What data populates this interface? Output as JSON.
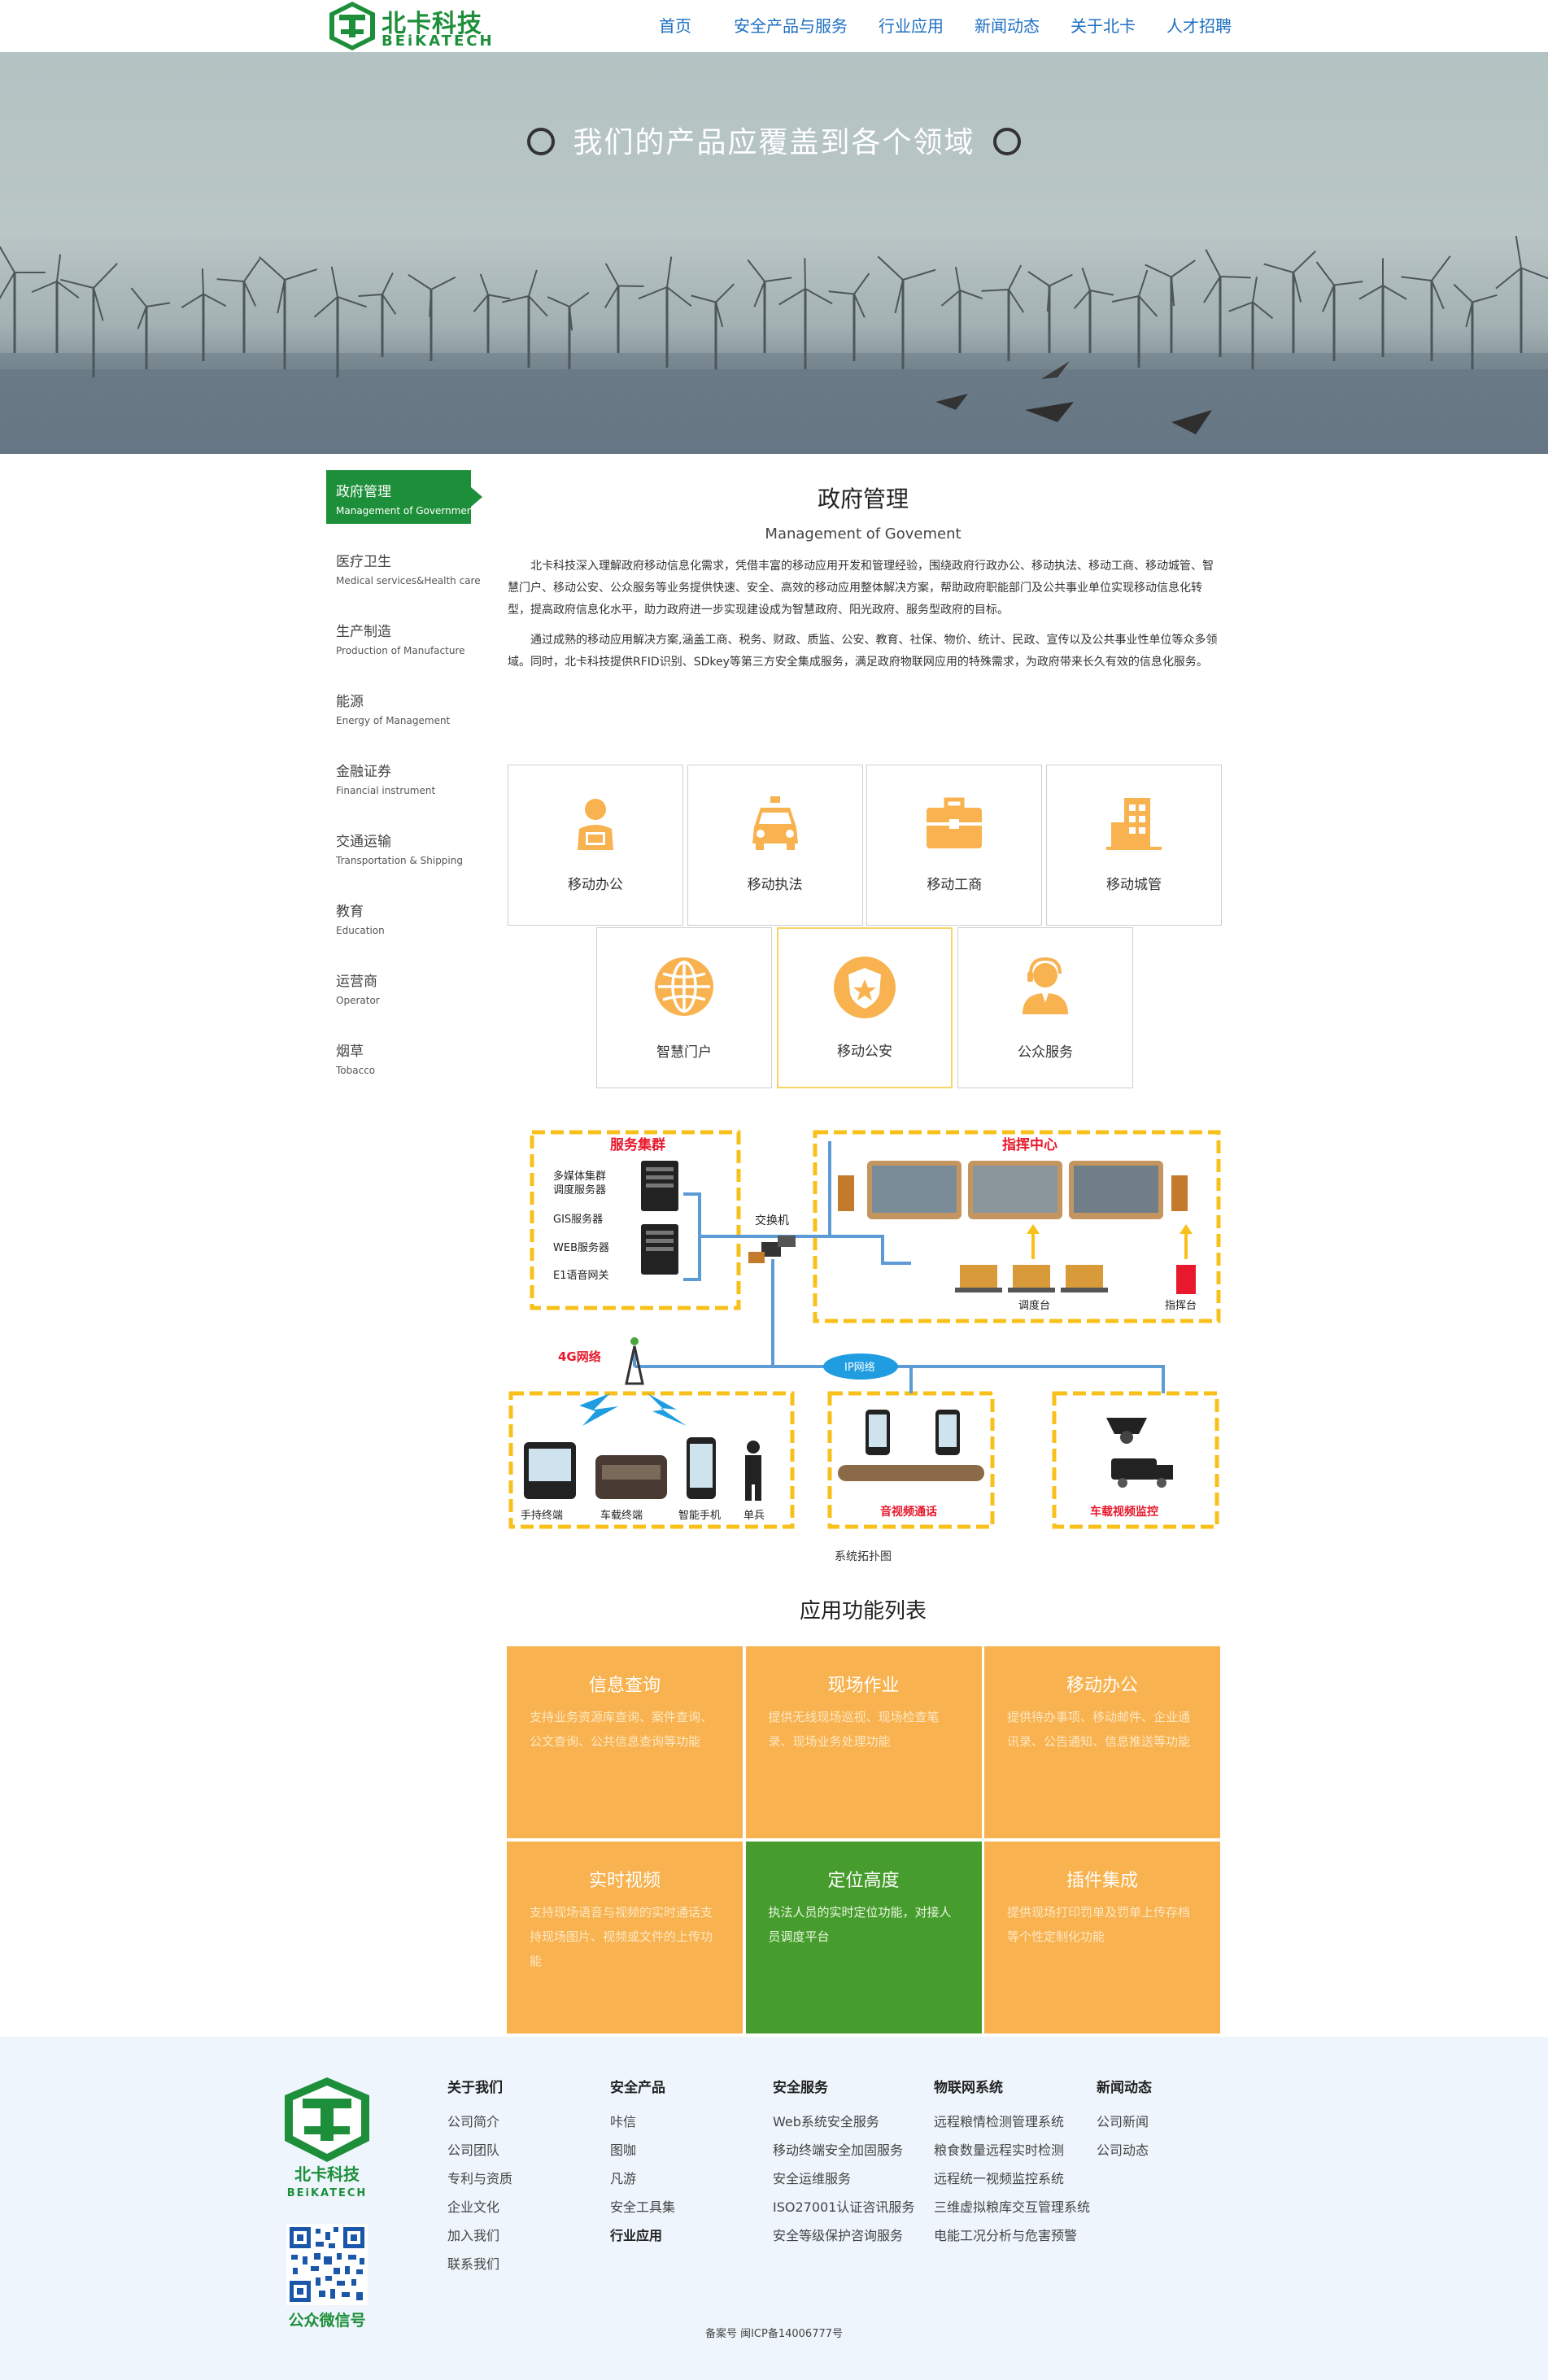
{
  "brand": {
    "name_cn": "北卡科技",
    "name_en": "BEiKATECH"
  },
  "nav": [
    "首页",
    "安全产品与服务",
    "行业应用",
    "新闻动态",
    "关于北卡",
    "人才招聘"
  ],
  "banner": {
    "title": "我们的产品应覆盖到各个领域"
  },
  "sidebar": [
    {
      "cn": "政府管理",
      "en": "Management of Government",
      "active": true
    },
    {
      "cn": "医疗卫生",
      "en": "Medical services&Health care"
    },
    {
      "cn": "生产制造",
      "en": "Production of Manufacture"
    },
    {
      "cn": "能源",
      "en": "Energy of Management"
    },
    {
      "cn": "金融证券",
      "en": "Financial instrument"
    },
    {
      "cn": "交通运输",
      "en": "Transportation & Shipping"
    },
    {
      "cn": "教育",
      "en": "Education"
    },
    {
      "cn": "运营商",
      "en": "Operator"
    },
    {
      "cn": "烟草",
      "en": "Tobacco"
    }
  ],
  "main": {
    "title_cn": "政府管理",
    "title_en": "Management of Govement",
    "paragraphs": [
      "北卡科技深入理解政府移动信息化需求，凭借丰富的移动应用开发和管理经验，围绕政府行政办公、移动执法、移动工商、移动城管、智慧门户、移动公安、公众服务等业务提供快速、安全、高效的移动应用整体解决方案，帮助政府职能部门及公共事业单位实现移动信息化转型，提高政府信息化水平，助力政府进一步实现建设成为智慧政府、阳光政府、服务型政府的目标。",
      "通过成熟的移动应用解决方案,涵盖工商、税务、财政、质监、公安、教育、社保、物价、统计、民政、宣传以及公共事业性单位等众多领域。同时，北卡科技提供RFID识别、SDkey等第三方安全集成服务，满足政府物联网应用的特殊需求，为政府带来长久有效的信息化服务。"
    ],
    "cards": [
      {
        "label": "移动办公",
        "icon": "office-worker-icon"
      },
      {
        "label": "移动执法",
        "icon": "police-car-icon"
      },
      {
        "label": "移动工商",
        "icon": "briefcase-icon"
      },
      {
        "label": "移动城管",
        "icon": "building-icon"
      },
      {
        "label": "智慧门户",
        "icon": "globe-icon"
      },
      {
        "label": "移动公安",
        "icon": "police-badge-icon"
      },
      {
        "label": "公众服务",
        "icon": "customer-service-icon"
      }
    ],
    "accent_color": "#f8b24f"
  },
  "topology": {
    "server_group": "服务集群",
    "servers": [
      "多媒体集群",
      "调度服务器",
      "GIS服务器",
      "WEB服务器",
      "E1语音网关"
    ],
    "switch": "交换机",
    "command_center": "指挥中心",
    "dispatch": "调度台",
    "command_desk": "指挥台",
    "network_4g": "4G网络",
    "ip_network": "IP网络",
    "terminals": [
      "手持终端",
      "车载终端",
      "智能手机",
      "单兵"
    ],
    "av_comm": "音视频通话",
    "vehicle_video": "车载视频监控",
    "caption": "系统拓扑图"
  },
  "features": {
    "title": "应用功能列表",
    "items": [
      {
        "title": "信息查询",
        "desc": "支持业务资源库查询、案件查询、公文查询、公共信息查询等功能",
        "color": "#f8b24f"
      },
      {
        "title": "现场作业",
        "desc": "提供无线现场巡视、现场检查笔录、现场业务处理功能",
        "color": "#f8b24f"
      },
      {
        "title": "移动办公",
        "desc": "提供待办事项、移动邮件、企业通讯录、公告通知、信息推送等功能",
        "color": "#f8b24f"
      },
      {
        "title": "实时视频",
        "desc": "支持现场语音与视频的实时通话支持现场图片、视频或文件的上传功能",
        "color": "#f8b24f"
      },
      {
        "title": "定位高度",
        "desc": "执法人员的实时定位功能，对接人员调度平台",
        "color": "#469d2d"
      },
      {
        "title": "插件集成",
        "desc": "提供现场打印罚单及罚单上传存档等个性定制化功能",
        "color": "#f8b24f"
      }
    ]
  },
  "footer": {
    "qr_label": "公众微信号",
    "columns": [
      {
        "head": "关于我们",
        "items": [
          "公司简介",
          "公司团队",
          "专利与资质",
          "企业文化",
          "加入我们",
          "联系我们"
        ]
      },
      {
        "head": "安全产品",
        "items": [
          "咔信",
          "图咖",
          "凡游",
          "安全工具集"
        ],
        "extra_head": "行业应用"
      },
      {
        "head": "安全服务",
        "items": [
          "Web系统安全服务",
          "移动终端安全加固服务",
          "安全运维服务",
          "ISO27001认证咨讯服务",
          "安全等级保护咨询服务"
        ]
      },
      {
        "head": "物联网系统",
        "items": [
          "远程粮情检测管理系统",
          "粮食数量远程实时检测",
          "远程统一视频监控系统",
          "三维虚拟粮库交互管理系统",
          "电能工况分析与危害预警"
        ]
      },
      {
        "head": "新闻动态",
        "items": [
          "公司新闻",
          "公司动态"
        ]
      }
    ],
    "icp": "备案号  闽ICP备14006777号"
  },
  "colors": {
    "brand_green": "#1d8f3a",
    "nav_blue": "#1d6fc1",
    "feature_orange": "#f8b24f",
    "feature_green": "#469d2d",
    "footer_bg": "#eef5fc"
  }
}
